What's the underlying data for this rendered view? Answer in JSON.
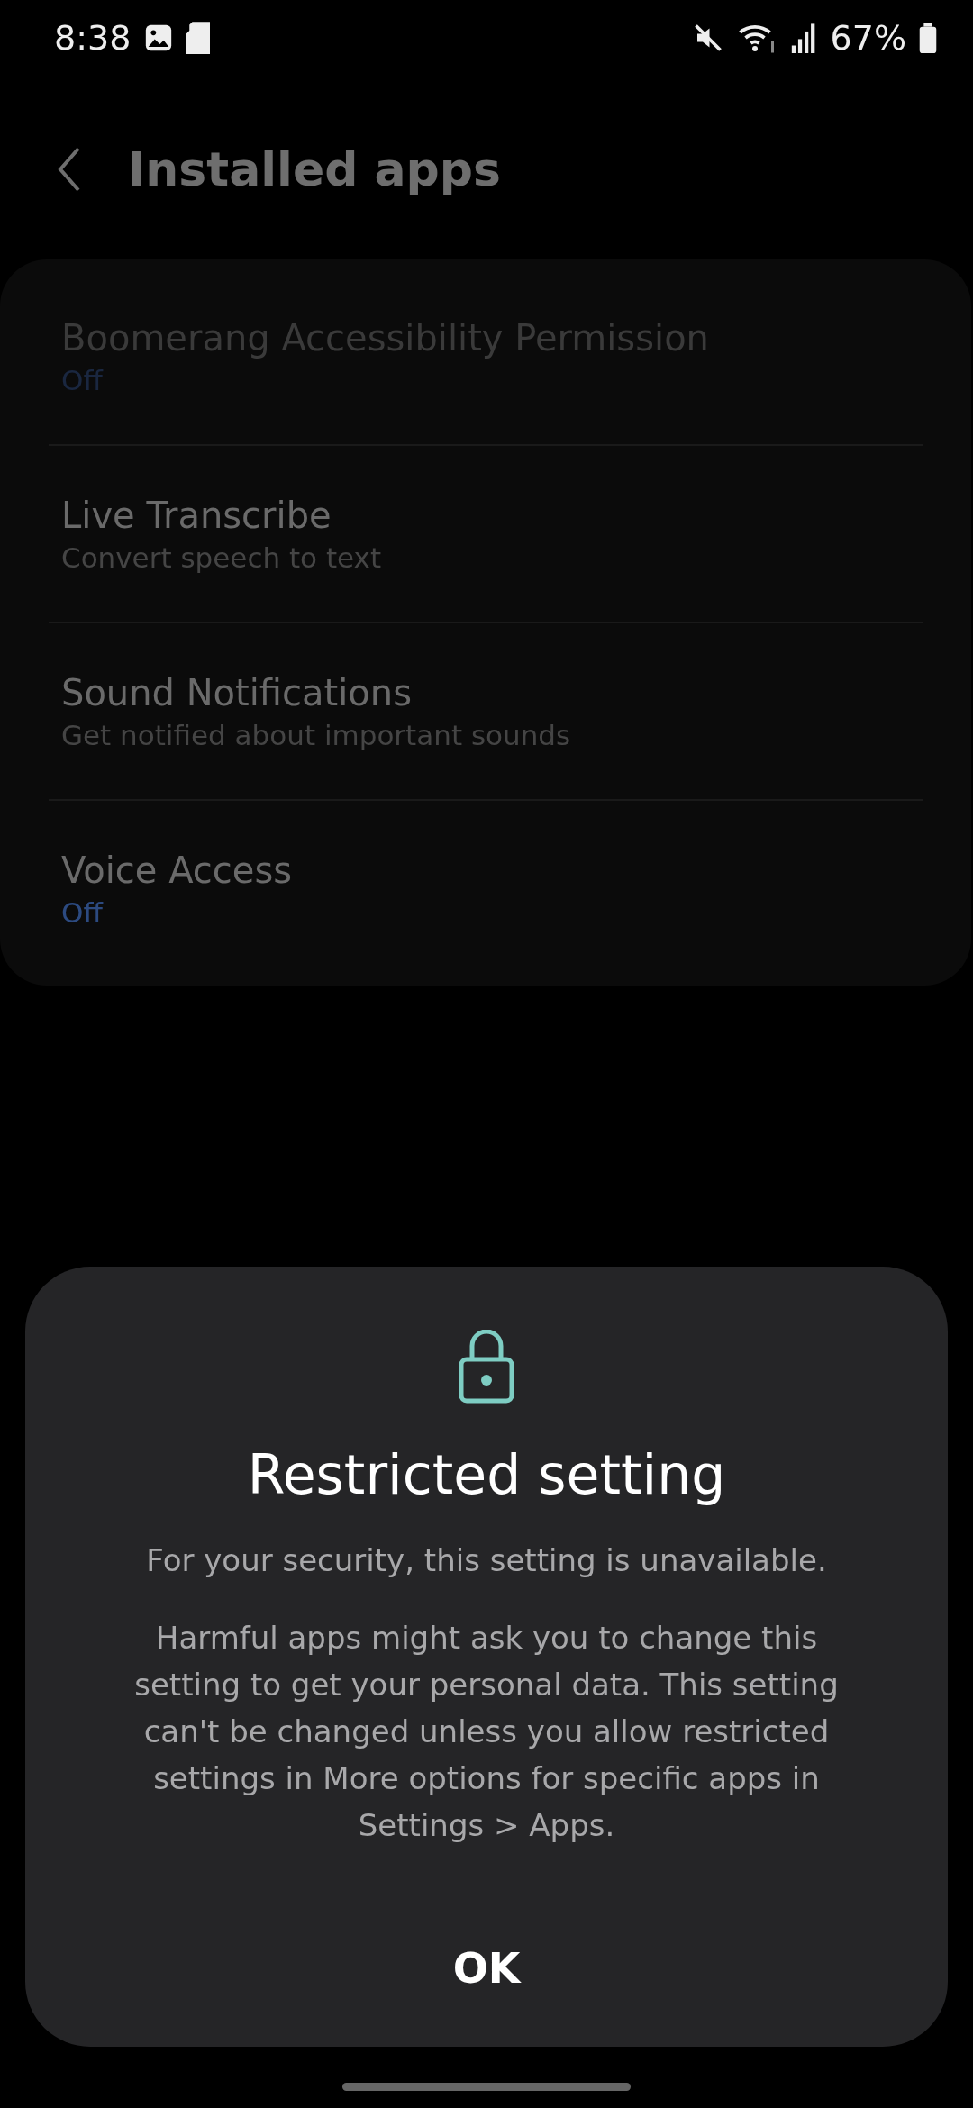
{
  "status_bar": {
    "time": "8:38",
    "battery": "67%"
  },
  "header": {
    "title": "Installed apps"
  },
  "apps": [
    {
      "name": "Boomerang Accessibility Permission",
      "subtitle": "Off",
      "kind": "status",
      "disabled": true
    },
    {
      "name": "Live Transcribe",
      "subtitle": "Convert speech to text",
      "kind": "summary",
      "disabled": false
    },
    {
      "name": "Sound Notifications",
      "subtitle": "Get notified about important sounds",
      "kind": "summary",
      "disabled": false
    },
    {
      "name": "Voice Access",
      "subtitle": "Off",
      "kind": "status",
      "disabled": false
    }
  ],
  "dialog": {
    "title": "Restricted setting",
    "paragraphs": [
      "For your security, this setting is unavailable.",
      "Harmful apps might ask you to change this setting to get your personal data. This setting can't be changed unless you allow restricted settings in More options for specific apps in Settings > Apps."
    ],
    "button": "OK"
  }
}
